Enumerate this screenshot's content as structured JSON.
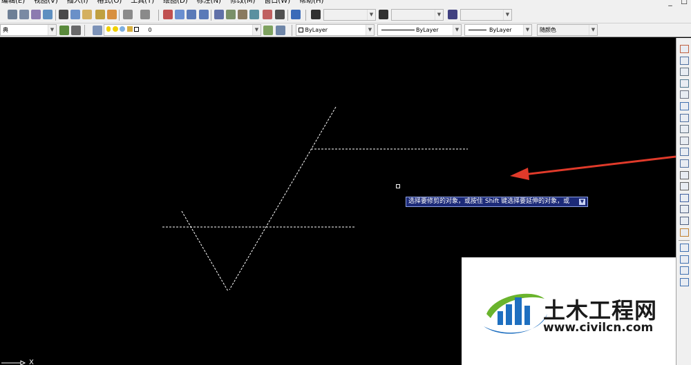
{
  "menu": {
    "items": [
      "编辑(E)",
      "视图(V)",
      "插入(I)",
      "格式(O)",
      "工具(T)",
      "绘图(D)",
      "标注(N)",
      "修改(M)",
      "窗口(W)",
      "帮助(H)"
    ],
    "window_buttons": [
      "_",
      "☐"
    ]
  },
  "toolbar2": {
    "workspace_value": "典",
    "layer_value": "0",
    "color_value": "ByLayer",
    "linetype_value": "ByLayer",
    "lineweight_value": "ByLayer",
    "plotstyle_value": "随颜色"
  },
  "icons": {
    "toolbar1": [
      "print-icon",
      "print-preview-icon",
      "publish-icon",
      "3d-dwf-icon",
      "cut-icon",
      "copy-icon",
      "paste-icon",
      "match-properties-icon",
      "block-editor-icon",
      "undo-icon",
      "redo-icon",
      "pan-icon",
      "zoom-realtime-icon",
      "zoom-window-icon",
      "zoom-previous-icon",
      "properties-icon",
      "design-center-icon",
      "tool-palettes-icon",
      "sheet-set-icon",
      "markup-icon",
      "calculator-icon",
      "help-icon",
      "text-style-icon",
      "dim-style-icon",
      "table-style-icon"
    ],
    "right_toolbar": [
      "erase-icon",
      "copy-object-icon",
      "mirror-icon",
      "offset-icon",
      "array-icon",
      "move-icon",
      "rotate-icon",
      "scale-icon",
      "stretch-icon",
      "trim-icon",
      "extend-icon",
      "break-at-point-icon",
      "break-icon",
      "join-icon",
      "chamfer-icon",
      "fillet-icon",
      "explode-icon",
      "draworder-icon",
      "draworder-front-icon",
      "draworder-back-icon",
      "text-front-icon"
    ]
  },
  "drawing": {
    "tooltip_text": "选择要修剪的对象，或按住 Shift 键选择要延伸的对象，或",
    "tooltip_arrow": "▼",
    "ucs_label": "X"
  },
  "watermark": {
    "title": "土木工程网",
    "url": "www.civilcn.com"
  },
  "colors": {
    "canvas": "#000000",
    "toolbar_bg": "#f0f0f0",
    "tooltip_bg": "#1c2a78",
    "arrow_red": "#e03a2a",
    "dashed_line": "#ffffff",
    "watermark_blue": "#1e6fc0",
    "watermark_green": "#6ab42d"
  }
}
